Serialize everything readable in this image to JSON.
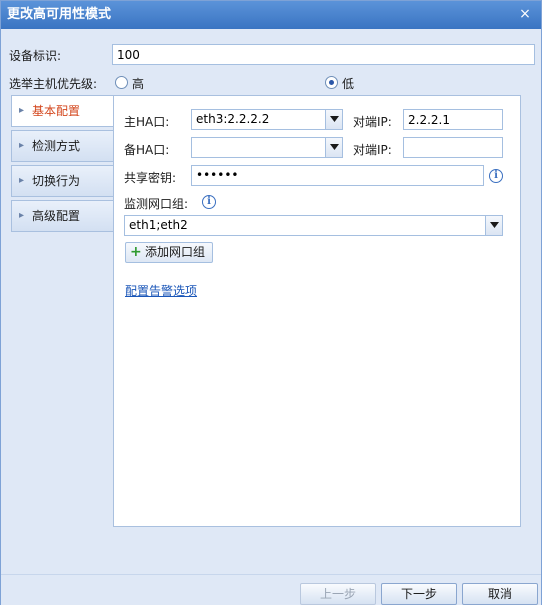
{
  "window": {
    "title": "更改高可用性模式",
    "close_glyph": "×"
  },
  "device_id": {
    "label": "设备标识:",
    "value": "100"
  },
  "priority": {
    "label": "选举主机优先级:",
    "options": [
      {
        "label": "高",
        "checked": false
      },
      {
        "label": "低",
        "checked": true
      }
    ]
  },
  "nav": {
    "items": [
      {
        "label": "基本配置",
        "active": true
      },
      {
        "label": "检测方式",
        "active": false
      },
      {
        "label": "切换行为",
        "active": false
      },
      {
        "label": "高级配置",
        "active": false
      }
    ]
  },
  "basic": {
    "primary_ha": {
      "label": "主HA口:",
      "value": "eth3:2.2.2.2"
    },
    "primary_peer_ip": {
      "label": "对端IP:",
      "value": "2.2.2.1"
    },
    "backup_ha": {
      "label": "备HA口:",
      "value": ""
    },
    "backup_peer_ip": {
      "label": "对端IP:",
      "value": ""
    },
    "shared_key": {
      "label": "共享密钥:",
      "value": "••••••"
    },
    "monitor_group": {
      "label": "监测网口组:",
      "value": "eth1;eth2"
    },
    "add_group_label": "添加网口组",
    "alert_link": "配置告警选项"
  },
  "footer": {
    "prev": "上一步",
    "next": "下一步",
    "cancel": "取消"
  },
  "colors": {
    "title_bar": "#3a74c2",
    "active_nav_text": "#d3461c",
    "link": "#1a56b8"
  }
}
